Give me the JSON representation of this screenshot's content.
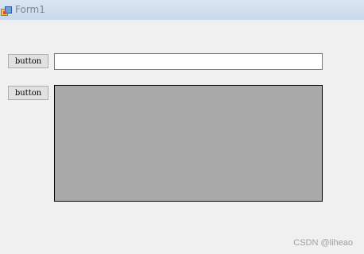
{
  "window": {
    "title": "Form1",
    "icon": "form-app-icon"
  },
  "controls": {
    "button1_label": "button",
    "button2_label": "button",
    "textbox_value": "",
    "panel_color": "#a9a9a9"
  },
  "watermark": {
    "text": "CSDN @liheao"
  },
  "colors": {
    "form_background": "#f0f0f0",
    "titlebar": "#c9d8eb",
    "button_face": "#e1e1e1"
  }
}
